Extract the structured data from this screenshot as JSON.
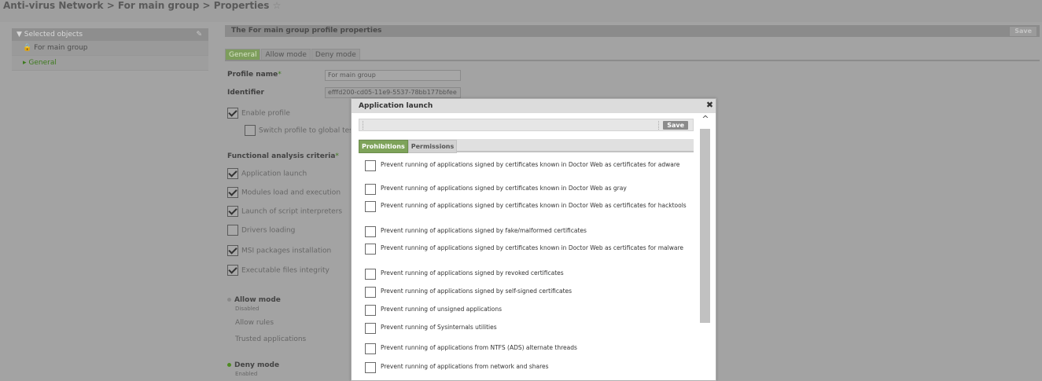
{
  "breadcrumb": {
    "text": "Anti-virus Network > For main group > Properties",
    "star": "☆"
  },
  "sidebar": {
    "header": "▼ Selected objects",
    "items": [
      {
        "label": "For main group",
        "icon": "lock-icon"
      },
      {
        "label": "▸ General"
      }
    ]
  },
  "main": {
    "title": "The For main group profile properties",
    "save_label": "Save",
    "tabs": [
      "General",
      "Allow mode",
      "Deny mode"
    ],
    "form": {
      "profile_name_label": "Profile name",
      "profile_name_value": "For main group",
      "identifier_label": "Identifier",
      "identifier_value": "efffd200-cd05-11e9-5537-78bb177bbfee",
      "enable_profile": "Enable profile",
      "switch_profile": "Switch profile to global test m",
      "criteria_label": "Functional analysis criteria",
      "criteria": [
        {
          "label": "Application launch",
          "checked": true
        },
        {
          "label": "Modules load and execution",
          "checked": true
        },
        {
          "label": "Launch of script interpreters",
          "checked": true
        },
        {
          "label": "Drivers loading",
          "checked": false
        },
        {
          "label": "MSI packages installation",
          "checked": true
        },
        {
          "label": "Executable files integrity",
          "checked": true
        }
      ],
      "allow_mode": {
        "title": "Allow mode",
        "status": "Disabled",
        "links": [
          "Allow rules",
          "Trusted applications"
        ]
      },
      "deny_mode": {
        "title": "Deny mode",
        "status": "Enabled"
      }
    }
  },
  "dialog": {
    "title": "Application launch",
    "save_label": "Save",
    "tabs": [
      "Prohibitions",
      "Permissions"
    ],
    "items": [
      "Prevent running of applications signed by certificates known in Doctor Web as certificates for adware",
      "Prevent running of applications signed by certificates known in Doctor Web as gray",
      "Prevent running of applications signed by certificates known in Doctor Web as certificates for hacktools",
      "Prevent running of applications signed by fake/malformed certificates",
      "Prevent running of applications signed by certificates known in Doctor Web as certificates for malware",
      "Prevent running of applications signed by revoked certificates",
      "Prevent running of applications signed by self-signed certificates",
      "Prevent running of unsigned applications",
      "Prevent running of Sysinternals utilities",
      "Prevent running of applications from NTFS (ADS) alternate threads",
      "Prevent running of applications from network and shares"
    ]
  }
}
